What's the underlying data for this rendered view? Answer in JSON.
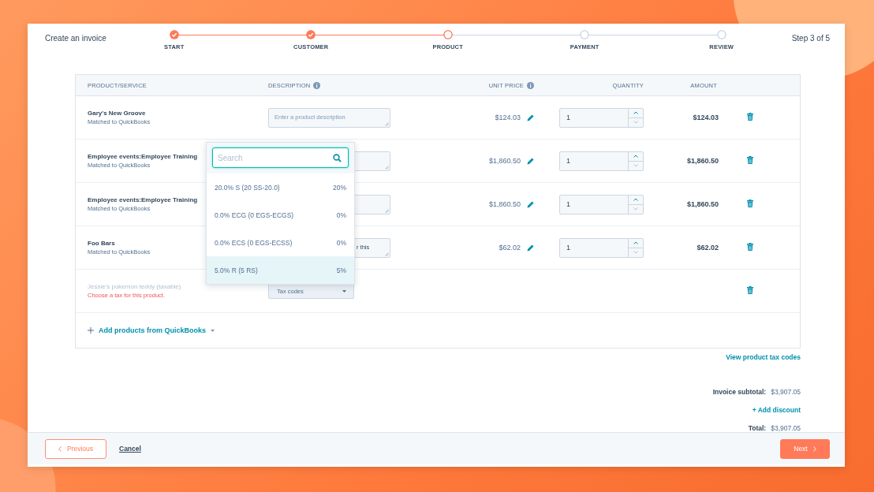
{
  "header": {
    "title": "Create an invoice",
    "step_counter": "Step 3 of 5"
  },
  "steps": [
    {
      "label": "START",
      "done": true
    },
    {
      "label": "CUSTOMER",
      "done": true
    },
    {
      "label": "PRODUCT",
      "done": false
    },
    {
      "label": "PAYMENT",
      "done": false
    },
    {
      "label": "REVIEW",
      "done": false
    }
  ],
  "table": {
    "columns": [
      {
        "label": "PRODUCT/SERVICE"
      },
      {
        "label": "DESCRIPTION",
        "info": true
      },
      {
        "label": "UNIT PRICE",
        "info": true
      },
      {
        "label": "QUANTITY"
      },
      {
        "label": "AMOUNT"
      }
    ],
    "rows": [
      {
        "kind": "item",
        "name": "Gary's New Groove",
        "match": "Matched to QuickBooks",
        "description_placeholder": "Enter a product description",
        "unit_price": "$124.03",
        "quantity": "1",
        "amount": "$124.03"
      },
      {
        "kind": "item",
        "name": "Employee events:Employee Training",
        "match": "Matched to QuickBooks",
        "unit_price": "$1,860.50",
        "quantity": "1",
        "amount": "$1,860.50"
      },
      {
        "kind": "item",
        "name": "Employee events:Employee Training",
        "match": "Matched to QuickBooks",
        "unit_price": "$1,860.50",
        "quantity": "1",
        "amount": "$1,860.50"
      },
      {
        "kind": "item",
        "name": "Foo Bars",
        "match": "Matched to QuickBooks",
        "description": "r this",
        "unit_price": "$62.02",
        "quantity": "1",
        "amount": "$62.02"
      },
      {
        "kind": "needs_tax",
        "name": "Jessie's pokemon teddy (taxable)",
        "disabled": true,
        "error": "Choose a tax for this product.",
        "tax_select": "Tax codes"
      }
    ],
    "add_products": "Add products from QuickBooks"
  },
  "tax_dropdown": {
    "search_placeholder": "Search",
    "options": [
      {
        "label": "20.0% S (20 SS-20.0)",
        "rate": "20%",
        "selected": false
      },
      {
        "label": "0.0% ECG (0 EGS-ECGS)",
        "rate": "0%",
        "selected": false
      },
      {
        "label": "0.0% ECS (0 EGS-ECSS)",
        "rate": "0%",
        "selected": false
      },
      {
        "label": "5.0% R (5 RS)",
        "rate": "5%",
        "selected": true
      }
    ]
  },
  "tax_codes_link": "View product tax codes",
  "totals": {
    "subtotal_label": "Invoice subtotal:",
    "subtotal": "$3,907.05",
    "add_discount": "+ Add discount",
    "total_label": "Total:",
    "total": "$3,907.05"
  },
  "footer": {
    "previous": "Previous",
    "cancel": "Cancel",
    "next": "Next"
  }
}
